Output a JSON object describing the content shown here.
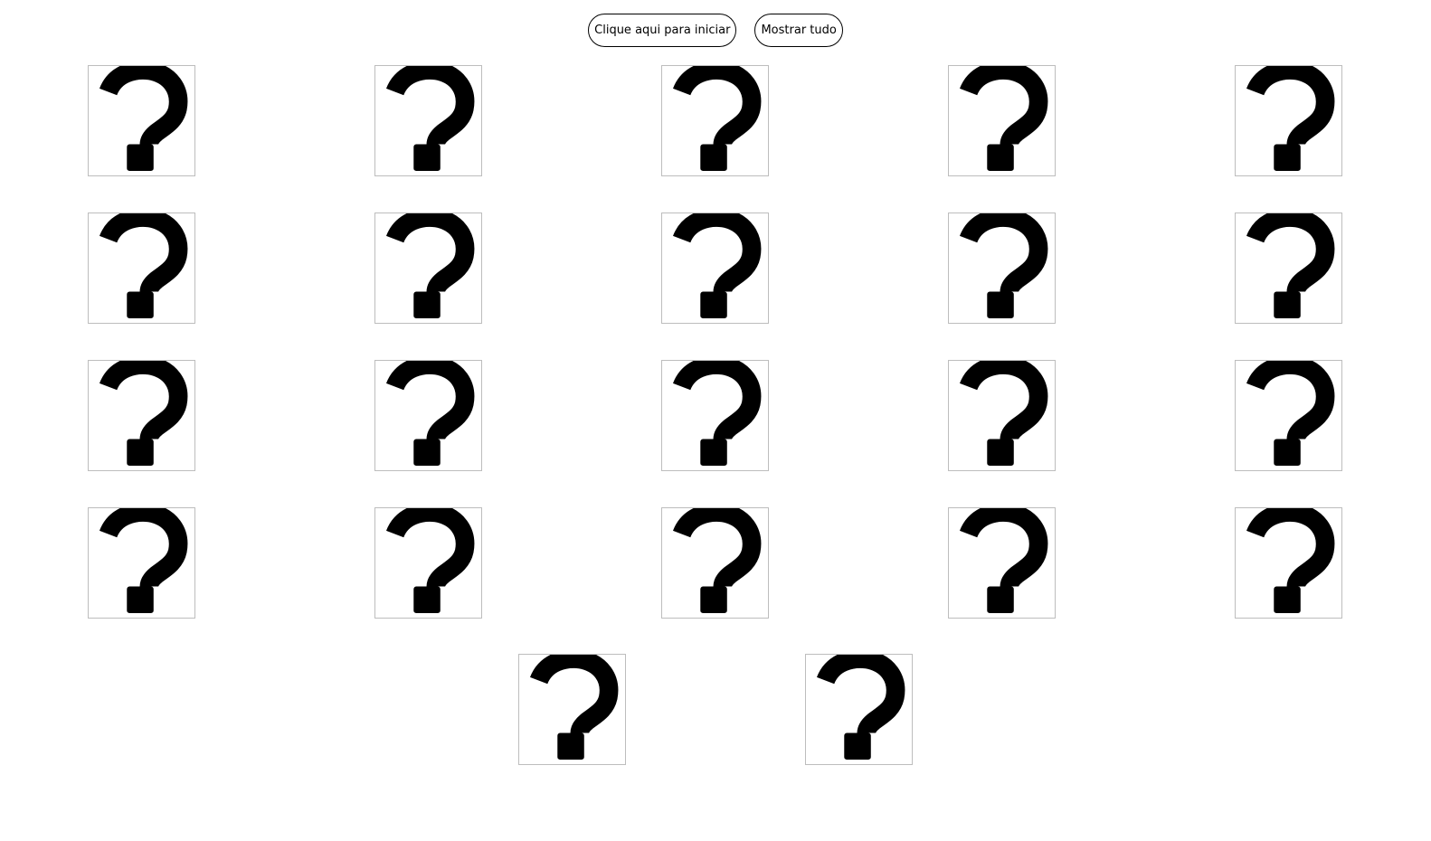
{
  "controls": {
    "start_label": "Clique aqui para iniciar",
    "show_all_label": "Mostrar tudo"
  },
  "board": {
    "card_face": "question-mark-icon",
    "card_count": 22,
    "colors": {
      "card_border": "#bdbdbd",
      "icon": "#000000"
    }
  }
}
